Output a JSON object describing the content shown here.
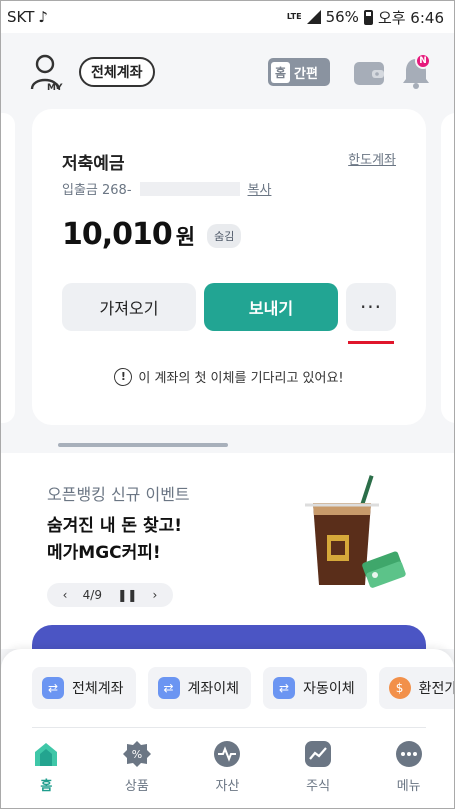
{
  "status_bar": {
    "carrier": "SKT",
    "network": "LTE",
    "battery": "56%",
    "time": "오후 6:46"
  },
  "header": {
    "my_label": "MY",
    "all_accounts_button": "전체계좌",
    "mode_home": "홈",
    "mode_simple": "간편",
    "notification_badge": "N"
  },
  "account_card": {
    "title": "저축예금",
    "limit_link": "한도계좌",
    "account_prefix": "입출금 268-",
    "copy_link": "복사",
    "balance_amount": "10,010",
    "balance_unit": "원",
    "hide_chip": "숨김",
    "get_button": "가져오기",
    "send_button": "보내기",
    "more_button": "···",
    "notice": "이 계좌의 첫 이체를 기다리고 있어요!"
  },
  "event": {
    "subtitle": "오픈뱅킹 신규 이벤트",
    "title_line1": "숨겨진 내 돈 찾고!",
    "title_line2": "메가MGC커피!",
    "pager": "4/9"
  },
  "quick_actions": [
    {
      "label": "전체계좌",
      "icon": "transfer-arrows-icon"
    },
    {
      "label": "계좌이체",
      "icon": "transfer-arrows-icon"
    },
    {
      "label": "자동이체",
      "icon": "transfer-arrows-icon"
    },
    {
      "label": "환전가",
      "icon": "dollar-coin-icon"
    }
  ],
  "tabs": [
    {
      "label": "홈",
      "icon": "home-icon",
      "active": true
    },
    {
      "label": "상품",
      "icon": "product-badge-icon"
    },
    {
      "label": "자산",
      "icon": "asset-pulse-icon"
    },
    {
      "label": "주식",
      "icon": "stock-chart-icon"
    },
    {
      "label": "메뉴",
      "icon": "menu-dots-icon"
    }
  ],
  "colors": {
    "primary_green": "#22a593",
    "banner_blue": "#4b55c4",
    "badge_pink": "#e6197c",
    "highlight_red": "#e0162b"
  }
}
